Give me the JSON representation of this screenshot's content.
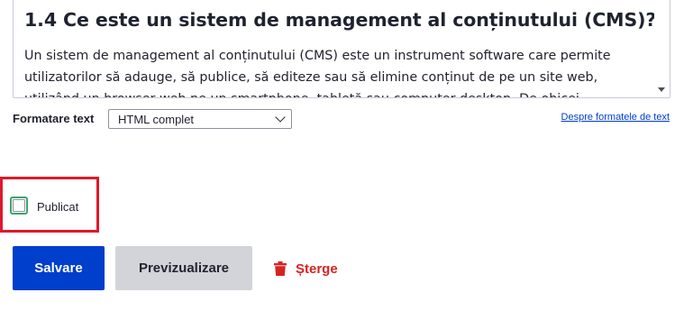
{
  "editor": {
    "heading": "1.4 Ce este un sistem de management al conținutului (CMS)?",
    "body_text": "Un sistem de management al conținutului (CMS) este un instrument software care permite utilizatorilor să adauge, să publice, să editeze sau să elimine conținut de pe un site web, utilizând un browser web pe un smartphone, tabletă sau computer desktop. De obicei, software-ul CMS"
  },
  "format": {
    "label": "Formatare text",
    "selected": "HTML complet",
    "help_link": "Despre formatele de text"
  },
  "published": {
    "label": "Publicat",
    "checked": false
  },
  "actions": {
    "save": "Salvare",
    "preview": "Previzualizare",
    "delete": "Șterge"
  },
  "colors": {
    "primary": "#003ecc",
    "danger": "#d72222",
    "highlight": "#e0182d",
    "checkbox_focus": "#3fa36d"
  }
}
